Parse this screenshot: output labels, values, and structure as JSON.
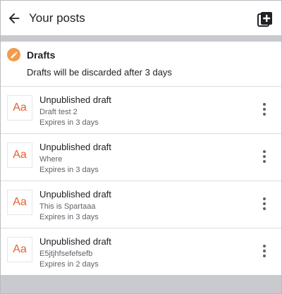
{
  "header": {
    "title": "Your posts",
    "back_icon": "arrow-left-icon",
    "new_post_icon": "new-post-icon"
  },
  "drafts": {
    "title": "Drafts",
    "note": "Drafts will be discarded after 3 days",
    "badge_icon": "pencil-icon",
    "badge_color": "#f29b4b"
  },
  "items": [
    {
      "thumb": "Aa",
      "title": "Unpublished draft",
      "subtitle": "Draft test 2",
      "expires": "Expires in 3 days"
    },
    {
      "thumb": "Aa",
      "title": "Unpublished draft",
      "subtitle": "Where",
      "expires": "Expires in 3 days"
    },
    {
      "thumb": "Aa",
      "title": "Unpublished draft",
      "subtitle": "This is Spartaaa",
      "expires": "Expires in 3 days"
    },
    {
      "thumb": "Aa",
      "title": "Unpublished draft",
      "subtitle": "E5jtjhfsefefsefb",
      "expires": "Expires in 2 days"
    }
  ],
  "colors": {
    "thumb_text": "#e8612c",
    "background_band": "#c8cacd"
  }
}
